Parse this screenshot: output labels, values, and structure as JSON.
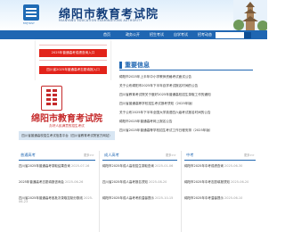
{
  "header": {
    "logo_sub": "MYJYKSY",
    "title": "绵阳市教育考试院",
    "subtitle": "MIANYANG EDUCATION EXAMINATIONS AUTHORITY"
  },
  "nav": {
    "items": [
      "首页",
      "政务公开",
      "招生考试",
      "自学考试",
      "招考动态"
    ],
    "search_placeholder": ""
  },
  "dropdown": {
    "items": [
      "2025年普通高考成绩查询入口",
      "四川省2025年普通高考志愿填报入口"
    ]
  },
  "promo": {
    "title": "绵阳市教育考试院",
    "subtitle": "办好人民满意的招生考试",
    "caption": "四川省普通高校招生考试信息平台（四川省教育考试院官方网站）"
  },
  "news": {
    "title": "重要信息",
    "items": [
      "绵阳市2025年上半年中小学教师资格考试面试公告",
      "关于公布绵阳市2025年下半年自学考试报名时间的公告",
      "四川省教育考试院关于做好2025年普通高校招生录取工作的通知",
      "四川省普通高等学校招生考试报考须知（2025年版）",
      "关于公布2025年下半年全国大学英语四六级考试报名时间的公告",
      "绵阳市2025年普通高考网上报名公告",
      "四川省2025年普通高等学校招生考试工作日程安排（2025年版）"
    ]
  },
  "sections": [
    {
      "tab": "普通高考",
      "more": "更多>>",
      "items": [
        {
          "text": "四川省2025年普通高考录取结果查询",
          "date": "2025-07-16"
        },
        {
          "text": "2025年普通高考志愿填报咨询会",
          "date": "2025-06-26"
        },
        {
          "text": "四川省2025年普通高考各批次录取控制分数线",
          "date": "2025-06-23"
        }
      ]
    },
    {
      "tab": "成人高考",
      "more": "更多>>",
      "items": [
        {
          "text": "绵阳市2025年成人高校招生录取查询",
          "date": "2025-01-06"
        },
        {
          "text": "四川省2025年成人高考报名须知",
          "date": "2025-08-20"
        },
        {
          "text": "绵阳市2025年成人高考考前温馨提示",
          "date": "2025-10-15"
        }
      ]
    },
    {
      "tab": "中考",
      "more": "更多>>",
      "items": [
        {
          "text": "绵阳市2025年中考成绩查询",
          "date": "2025-06-30"
        },
        {
          "text": "绵阳市2025年中考志愿填报须知",
          "date": "2025-06-20"
        },
        {
          "text": "绵阳市2025年中考温馨提示",
          "date": "2025-06-10"
        }
      ]
    }
  ],
  "colors": {
    "primary": "#1f66b2",
    "accent_red": "#e2231a",
    "brand_red": "#c5292a"
  }
}
